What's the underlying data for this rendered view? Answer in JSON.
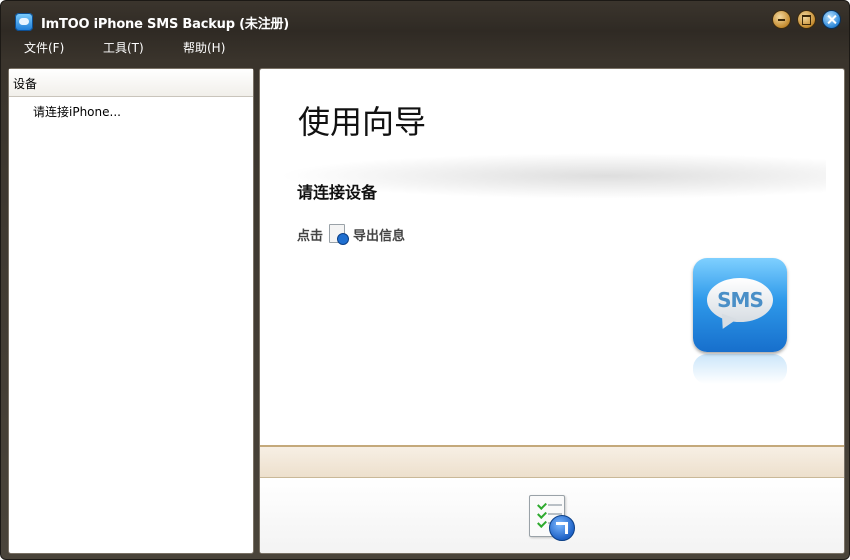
{
  "window": {
    "title": "ImTOO iPhone SMS Backup (未注册)",
    "app_icon": "sms-app-icon",
    "controls": [
      "minimize-icon",
      "maximize-icon",
      "close-icon"
    ]
  },
  "menu": {
    "file": "文件(F)",
    "tools": "工具(T)",
    "help": "帮助(H)"
  },
  "sidebar": {
    "header": "设备",
    "items": [
      {
        "label": "请连接iPhone..."
      }
    ]
  },
  "main": {
    "wizard_title": "使用向导",
    "section_title": "请连接设备",
    "instruction_prefix": "点击",
    "instruction_suffix": "导出信息",
    "sms_badge_text": "SMS",
    "export_button_icon": "export-document-icon"
  },
  "colors": {
    "titlebar": "#2f2a24",
    "accent_blue": "#2e99ea",
    "footer_band": "#f2e8d8"
  }
}
